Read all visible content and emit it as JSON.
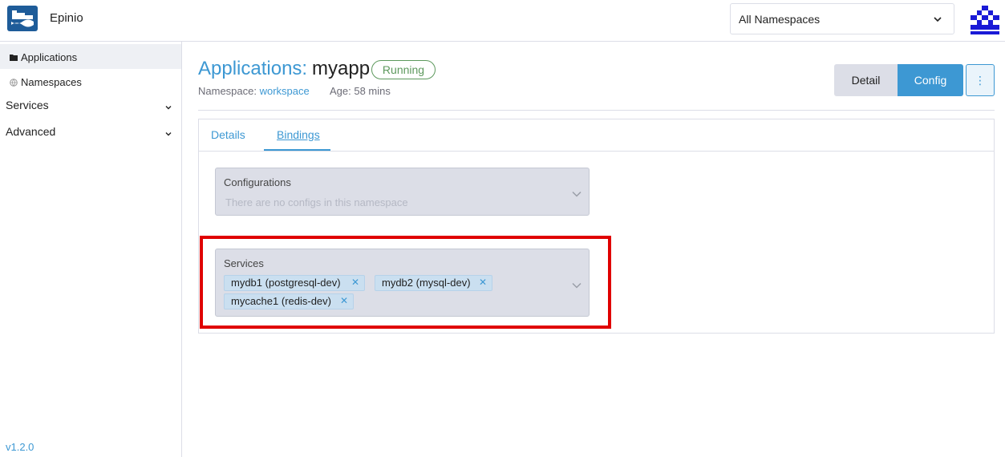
{
  "header": {
    "app_name": "Epinio",
    "namespace_select": "All Namespaces"
  },
  "sidebar": {
    "items": [
      {
        "label": "Applications",
        "active": true,
        "icon": "folder-icon"
      },
      {
        "label": "Namespaces",
        "active": false,
        "icon": "globe-icon"
      }
    ],
    "groups": [
      {
        "label": "Services"
      },
      {
        "label": "Advanced"
      }
    ],
    "version": "v1.2.0"
  },
  "page": {
    "title_prefix": "Applications:",
    "app_name": "myapp",
    "status": "Running",
    "namespace_label": "Namespace:",
    "namespace_value": "workspace",
    "age": "Age: 58 mins"
  },
  "toolbar": {
    "detail_label": "Detail",
    "config_label": "Config",
    "more_label": "⋮"
  },
  "tabs": [
    {
      "label": "Details",
      "active": false
    },
    {
      "label": "Bindings",
      "active": true
    }
  ],
  "bindings": {
    "configurations": {
      "label": "Configurations",
      "placeholder": "There are no configs in this namespace"
    },
    "services": {
      "label": "Services",
      "selected": [
        "mydb1 (postgresql-dev)",
        "mydb2 (mysql-dev)",
        "mycache1 (redis-dev)"
      ]
    }
  },
  "colors": {
    "accent": "#3d98d3",
    "success": "#5d995d",
    "highlight": "#e00000",
    "brand": "#1e5c99"
  }
}
